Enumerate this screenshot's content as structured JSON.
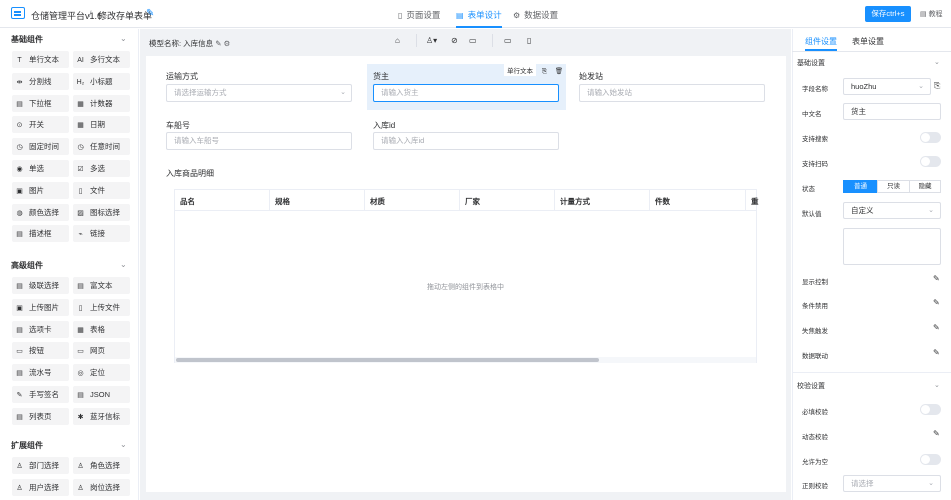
{
  "header": {
    "app_title": "仓储管理平台v1.6",
    "crumb_sep": "/",
    "form_title": "修改存单表单",
    "tabs": [
      "页面设置",
      "表单设计",
      "数据设置"
    ],
    "save_label": "保存ctrl+s",
    "tutorial_label": "教程"
  },
  "sidebar": {
    "groups": [
      {
        "title": "基础组件",
        "items": [
          {
            "label": "单行文本",
            "icon": "T"
          },
          {
            "label": "多行文本",
            "icon": "AI"
          },
          {
            "label": "分割线",
            "icon": "⇹"
          },
          {
            "label": "小标题",
            "icon": "H₂"
          },
          {
            "label": "下拉框",
            "icon": "▤"
          },
          {
            "label": "计数器",
            "icon": "▦"
          },
          {
            "label": "开关",
            "icon": "⊙"
          },
          {
            "label": "日期",
            "icon": "▦"
          },
          {
            "label": "固定时间",
            "icon": "◷"
          },
          {
            "label": "任意时间",
            "icon": "◷"
          },
          {
            "label": "单选",
            "icon": "◉"
          },
          {
            "label": "多选",
            "icon": "☑"
          },
          {
            "label": "图片",
            "icon": "▣"
          },
          {
            "label": "文件",
            "icon": "▯"
          },
          {
            "label": "颜色选择",
            "icon": "◍"
          },
          {
            "label": "图标选择",
            "icon": "▨"
          },
          {
            "label": "描述框",
            "icon": "▤"
          },
          {
            "label": "链接",
            "icon": "⌁"
          }
        ]
      },
      {
        "title": "高级组件",
        "items": [
          {
            "label": "级联选择",
            "icon": "▤"
          },
          {
            "label": "富文本",
            "icon": "▤"
          },
          {
            "label": "上传图片",
            "icon": "▣"
          },
          {
            "label": "上传文件",
            "icon": "▯"
          },
          {
            "label": "选项卡",
            "icon": "▤"
          },
          {
            "label": "表格",
            "icon": "▦"
          },
          {
            "label": "按钮",
            "icon": "▭"
          },
          {
            "label": "网页",
            "icon": "▭"
          },
          {
            "label": "流水号",
            "icon": "▤"
          },
          {
            "label": "定位",
            "icon": "◎"
          },
          {
            "label": "手写签名",
            "icon": "✎"
          },
          {
            "label": "JSON",
            "icon": "▤"
          },
          {
            "label": "列表页",
            "icon": "▤"
          },
          {
            "label": "蓝牙信标",
            "icon": "✱"
          }
        ]
      },
      {
        "title": "扩展组件",
        "items": [
          {
            "label": "部门选择",
            "icon": "♙"
          },
          {
            "label": "角色选择",
            "icon": "♙"
          },
          {
            "label": "用户选择",
            "icon": "♙"
          },
          {
            "label": "岗位选择",
            "icon": "♙"
          }
        ]
      }
    ]
  },
  "toolbar": {
    "model_label": "模型名称: 入库信息"
  },
  "form": {
    "fields": [
      {
        "label": "运输方式",
        "placeholder": "请选择运输方式",
        "type": "select"
      },
      {
        "label": "货主",
        "placeholder": "请输入货主",
        "type": "input"
      },
      {
        "label": "始发站",
        "placeholder": "请输入始发站",
        "type": "input"
      },
      {
        "label": "车船号",
        "placeholder": "请输入车船号",
        "type": "input"
      },
      {
        "label": "入库id",
        "placeholder": "请输入入库id",
        "type": "input"
      }
    ],
    "active_tag": "单行文本",
    "table_title": "入库商品明细",
    "table_headers": [
      "品名",
      "规格",
      "材质",
      "厂家",
      "计量方式",
      "件数",
      "重"
    ],
    "drag_hint": "拖动左侧的组件到表格中"
  },
  "right_panel": {
    "tabs": [
      "组件设置",
      "表单设置"
    ],
    "section_basic": "基础设置",
    "field_name_label": "字段名称",
    "field_name_value": "huoZhu",
    "cn_name_label": "中文名",
    "cn_name_value": "货主",
    "support_search_label": "支持搜索",
    "support_scan_label": "支持扫码",
    "state_label": "状态",
    "state_options": [
      "普通",
      "只读",
      "隐藏"
    ],
    "default_label": "默认值",
    "default_value": "自定义",
    "display_ctrl_label": "显示控制",
    "cond_disable_label": "条件禁用",
    "blur_trigger_label": "失焦触发",
    "data_link_label": "数据联动",
    "section_validate": "校验设置",
    "required_label": "必填校验",
    "dynamic_label": "动态校验",
    "allow_empty_label": "允许为空",
    "regex_label": "正则校验",
    "regex_placeholder": "请选择"
  },
  "colors": {
    "accent": "#1890ff",
    "canvas_bg": "#f0f2f5",
    "active_field_bg": "#e6f0fb"
  }
}
